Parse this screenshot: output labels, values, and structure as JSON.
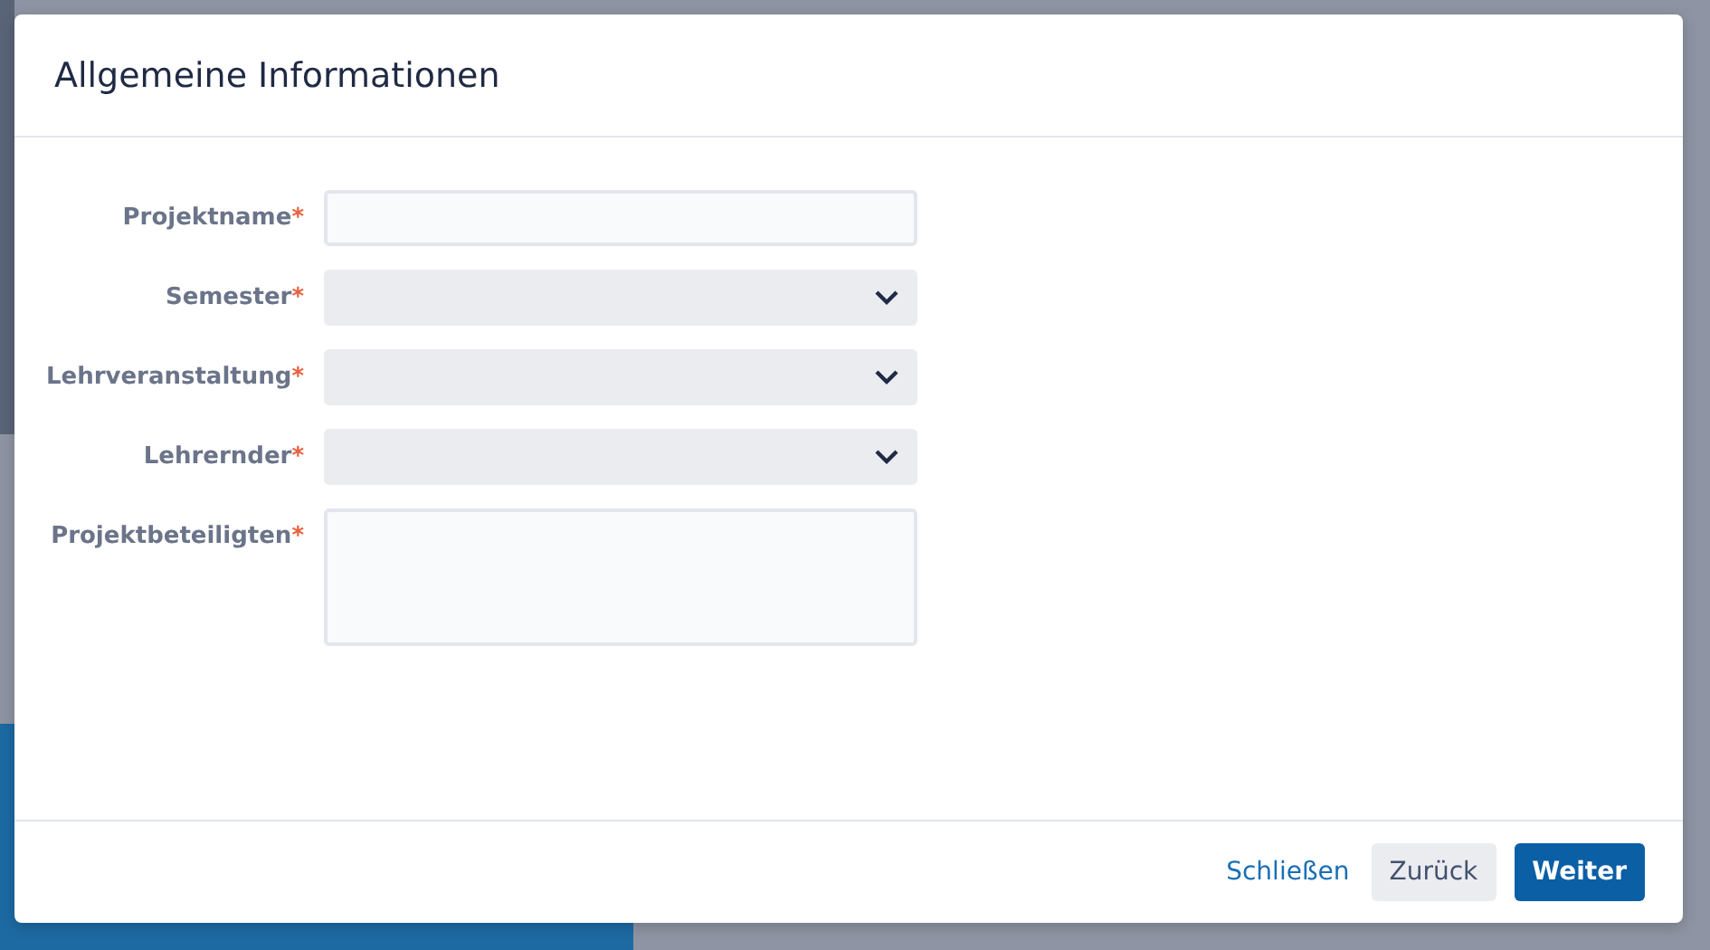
{
  "dialog": {
    "title": "Allgemeine Informationen",
    "fields": [
      {
        "kind": "text",
        "label": "Projektname",
        "required": true,
        "mark": "*"
      },
      {
        "kind": "select",
        "label": "Semester",
        "required": true,
        "mark": "*"
      },
      {
        "kind": "select",
        "label": "Lehrveranstaltung",
        "required": true,
        "mark": "*"
      },
      {
        "kind": "select",
        "label": "Lehrernder",
        "required": true,
        "mark": "*"
      },
      {
        "kind": "textarea",
        "label": "Projektbeteiligten",
        "required": true,
        "mark": "*"
      }
    ],
    "buttons": [
      {
        "kind": "link",
        "label": "Schließen"
      },
      {
        "kind": "secondary",
        "label": "Zurück"
      },
      {
        "kind": "primary",
        "label": "Weiter"
      }
    ]
  }
}
